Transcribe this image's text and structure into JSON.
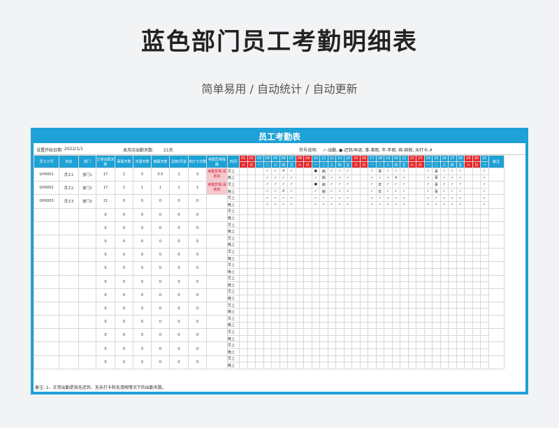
{
  "page": {
    "title": "蓝色部门员工考勤明细表",
    "subtitle": "简单易用  /  自动统计  /  自动更新"
  },
  "sheet": {
    "title": "员工考勤表",
    "start_label": "设置开始日期",
    "start_value": "2022/1/1",
    "days_label": "本月应出勤天数:",
    "days_value": "21天",
    "legend_label": "符号说明:",
    "legend_text": "✓-出勤, ●-迟到/早退, 事-事假, 年-年假, 病-病假, 未打卡-✗",
    "footnote": "备注: 1、正常出勤是指无迟到、无未打卡和无请假情况下的出勤天数。"
  },
  "headers": {
    "left": [
      "员工工号",
      "姓名",
      "部门",
      "正常出勤天数",
      "事假天数",
      "年假天数",
      "病假天数",
      "迟到/早退",
      "未打卡次数",
      "考勤异常提醒",
      "时间"
    ],
    "remark": "备注",
    "days": [
      "01",
      "02",
      "03",
      "04",
      "05",
      "06",
      "07",
      "08",
      "09",
      "10",
      "11",
      "12",
      "13",
      "14",
      "15",
      "16",
      "17",
      "18",
      "19",
      "20",
      "21",
      "22",
      "23",
      "24",
      "25",
      "26",
      "27",
      "28",
      "29",
      "30",
      "31"
    ],
    "weekdays": [
      "六",
      "日",
      "一",
      "二",
      "三",
      "四",
      "五",
      "六",
      "日",
      "一",
      "二",
      "三",
      "四",
      "五",
      "六",
      "日",
      "一",
      "二",
      "三",
      "四",
      "五",
      "六",
      "日",
      "一",
      "二",
      "三",
      "四",
      "五",
      "六",
      "日",
      "一"
    ],
    "red_days": [
      0,
      1,
      7,
      8,
      14,
      15,
      21,
      22,
      28,
      29
    ]
  },
  "employees": [
    {
      "id": "GH0001",
      "name": "员工1",
      "dept": "部门1",
      "normal": "17",
      "personal": "1",
      "annual": "0",
      "sick": "0.5",
      "late": "1",
      "miss": "3",
      "alert": "考勤异常,请核实"
    },
    {
      "id": "GH0002",
      "name": "员工2",
      "dept": "部门2",
      "normal": "17",
      "personal": "1",
      "annual": "1",
      "sick": "1",
      "late": "1",
      "miss": "1",
      "alert": "考勤异常,请核实"
    },
    {
      "id": "GH0003",
      "name": "员工3",
      "dept": "部门3",
      "normal": "21",
      "personal": "0",
      "annual": "0",
      "sick": "0",
      "late": "0",
      "miss": "0",
      "alert": ""
    },
    {
      "id": "",
      "name": "",
      "dept": "",
      "normal": "0",
      "personal": "0",
      "annual": "0",
      "sick": "0",
      "late": "0",
      "miss": "0",
      "alert": ""
    },
    {
      "id": "",
      "name": "",
      "dept": "",
      "normal": "0",
      "personal": "0",
      "annual": "0",
      "sick": "0",
      "late": "0",
      "miss": "0",
      "alert": ""
    },
    {
      "id": "",
      "name": "",
      "dept": "",
      "normal": "0",
      "personal": "0",
      "annual": "0",
      "sick": "0",
      "late": "0",
      "miss": "0",
      "alert": ""
    },
    {
      "id": "",
      "name": "",
      "dept": "",
      "normal": "0",
      "personal": "0",
      "annual": "0",
      "sick": "0",
      "late": "0",
      "miss": "0",
      "alert": ""
    },
    {
      "id": "",
      "name": "",
      "dept": "",
      "normal": "0",
      "personal": "0",
      "annual": "0",
      "sick": "0",
      "late": "0",
      "miss": "0",
      "alert": ""
    },
    {
      "id": "",
      "name": "",
      "dept": "",
      "normal": "0",
      "personal": "0",
      "annual": "0",
      "sick": "0",
      "late": "0",
      "miss": "0",
      "alert": ""
    },
    {
      "id": "",
      "name": "",
      "dept": "",
      "normal": "0",
      "personal": "0",
      "annual": "0",
      "sick": "0",
      "late": "0",
      "miss": "0",
      "alert": ""
    },
    {
      "id": "",
      "name": "",
      "dept": "",
      "normal": "0",
      "personal": "0",
      "annual": "0",
      "sick": "0",
      "late": "0",
      "miss": "0",
      "alert": ""
    },
    {
      "id": "",
      "name": "",
      "dept": "",
      "normal": "0",
      "personal": "0",
      "annual": "0",
      "sick": "0",
      "late": "0",
      "miss": "0",
      "alert": ""
    },
    {
      "id": "",
      "name": "",
      "dept": "",
      "normal": "0",
      "personal": "0",
      "annual": "0",
      "sick": "0",
      "late": "0",
      "miss": "0",
      "alert": ""
    },
    {
      "id": "",
      "name": "",
      "dept": "",
      "normal": "0",
      "personal": "0",
      "annual": "0",
      "sick": "0",
      "late": "0",
      "miss": "0",
      "alert": ""
    },
    {
      "id": "",
      "name": "",
      "dept": "",
      "normal": "0",
      "personal": "0",
      "annual": "0",
      "sick": "0",
      "late": "0",
      "miss": "0",
      "alert": ""
    }
  ],
  "period_labels": [
    "早上",
    "晚上"
  ],
  "marks": {
    "0": [
      [
        "",
        "",
        "",
        "✓",
        "✓",
        "✗",
        "✓",
        "",
        "",
        "●",
        "病",
        "✓",
        "✓",
        "✓",
        "",
        "",
        "✓",
        "事",
        "✓",
        "✓",
        "✓",
        "",
        "",
        "✓",
        "事",
        "✓",
        "✓",
        "✓",
        "",
        "",
        "✓"
      ],
      [
        "",
        "",
        "",
        "✓",
        "✓",
        "✓",
        "✓",
        "",
        "",
        "✓",
        "病",
        "✓",
        "✓",
        "✓",
        "",
        "",
        "✓",
        "✓",
        "✓",
        "✗",
        "✓",
        "",
        "",
        "✓",
        "事",
        "✓",
        "✓",
        "✓",
        "",
        "",
        "✓"
      ]
    ],
    "1": [
      [
        "",
        "",
        "",
        "✓",
        "✓",
        "✓",
        "✓",
        "",
        "",
        "●",
        "病",
        "✓",
        "✓",
        "✓",
        "",
        "",
        "✓",
        "年",
        "✓",
        "✓",
        "✓",
        "",
        "",
        "✓",
        "事",
        "✓",
        "✓",
        "✓",
        "",
        "",
        "✓"
      ],
      [
        "",
        "",
        "",
        "✓",
        "✓",
        "✗",
        "✓",
        "",
        "",
        "✓",
        "病",
        "✓",
        "✓",
        "✓",
        "",
        "",
        "✓",
        "年",
        "✓",
        "✓",
        "✓",
        "",
        "",
        "✓",
        "事",
        "✓",
        "✓",
        "✓",
        "",
        "",
        "✓"
      ]
    ],
    "2": [
      [
        "",
        "",
        "",
        "✓",
        "✓",
        "✓",
        "✓",
        "",
        "",
        "✓",
        "✓",
        "✓",
        "✓",
        "✓",
        "",
        "",
        "✓",
        "✓",
        "✓",
        "✓",
        "✓",
        "",
        "",
        "✓",
        "✓",
        "✓",
        "✓",
        "✓",
        "",
        "",
        "✓"
      ],
      [
        "",
        "",
        "",
        "✓",
        "✓",
        "✓",
        "✓",
        "",
        "",
        "✓",
        "✓",
        "✓",
        "✓",
        "✓",
        "",
        "",
        "✓",
        "✓",
        "✓",
        "✓",
        "✓",
        "",
        "",
        "✓",
        "✓",
        "✓",
        "✓",
        "✓",
        "",
        "",
        "✓"
      ]
    ]
  },
  "colors": {
    "accent": "#1da1d6",
    "weekend": "#e8262a",
    "alert_bg": "#f8c8cf"
  }
}
